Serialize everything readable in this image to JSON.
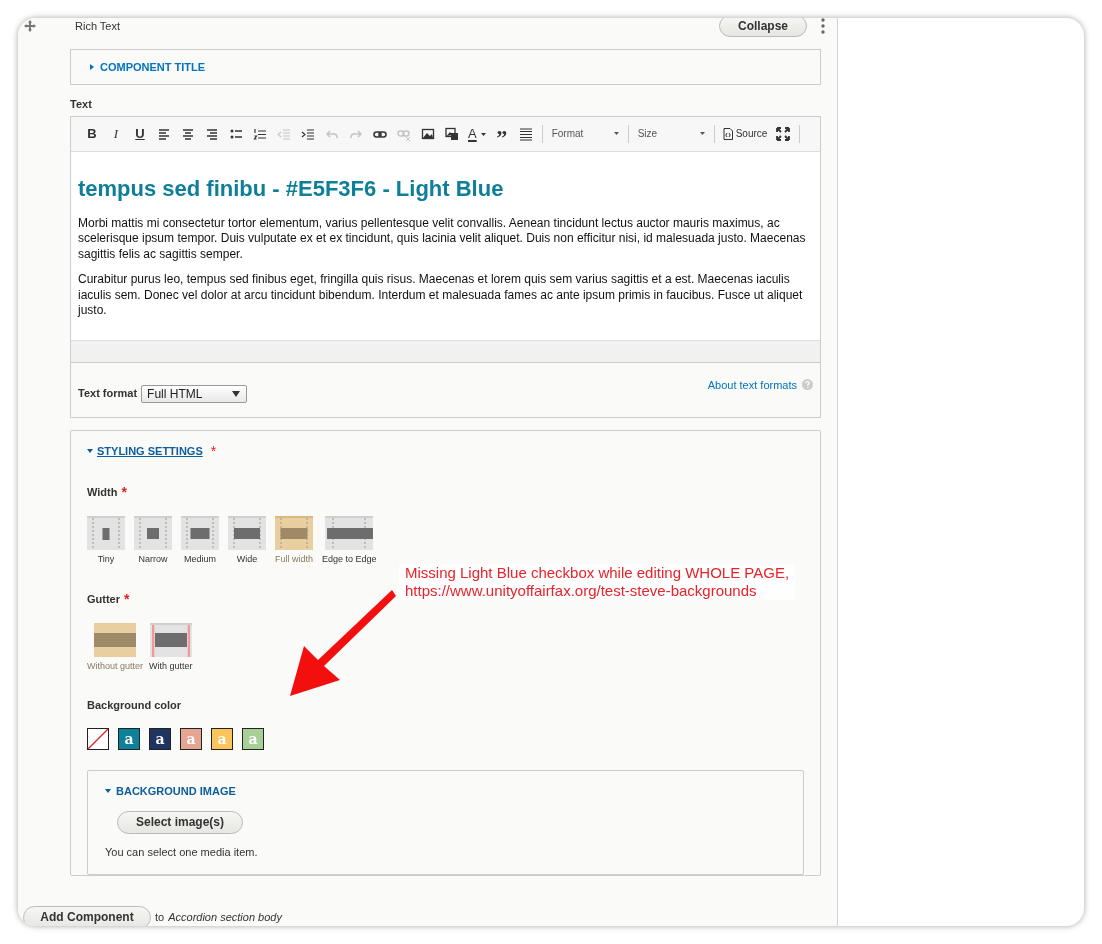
{
  "component": {
    "label": "Rich Text",
    "collapse_button": "Collapse"
  },
  "component_title": {
    "label": "COMPONENT TITLE",
    "expanded": false
  },
  "text_field": {
    "label": "Text",
    "toolbar": [
      {
        "kind": "bold",
        "label": "B",
        "disabled": false
      },
      {
        "kind": "italic",
        "label": "I",
        "disabled": false
      },
      {
        "kind": "underline",
        "label": "U",
        "disabled": false
      },
      {
        "kind": "align-left",
        "disabled": false
      },
      {
        "kind": "align-center",
        "disabled": false
      },
      {
        "kind": "align-right",
        "disabled": false
      },
      {
        "kind": "bullets",
        "disabled": false
      },
      {
        "kind": "numbers",
        "disabled": false
      },
      {
        "kind": "outdent",
        "disabled": true
      },
      {
        "kind": "indent",
        "disabled": false
      },
      {
        "kind": "undo",
        "disabled": true
      },
      {
        "kind": "redo",
        "disabled": true
      },
      {
        "kind": "link",
        "disabled": false
      },
      {
        "kind": "unlink",
        "disabled": true
      },
      {
        "kind": "image",
        "disabled": false
      },
      {
        "kind": "media",
        "disabled": false
      },
      {
        "kind": "text-color",
        "label": "A",
        "disabled": false
      },
      {
        "kind": "quote",
        "label": "”",
        "disabled": false
      },
      {
        "kind": "rule",
        "disabled": false
      },
      {
        "kind": "dropdown",
        "label": "Format",
        "disabled": false
      },
      {
        "kind": "dropdown",
        "label": "Size",
        "disabled": false
      },
      {
        "kind": "source",
        "label": "Source",
        "disabled": false
      },
      {
        "kind": "maximize",
        "disabled": false
      }
    ],
    "heading": "tempus sed finibu - #E5F3F6 - Light Blue",
    "paragraphs": [
      "Morbi mattis mi consectetur tortor elementum, varius pellentesque velit convallis. Aenean tincidunt lectus auctor mauris maximus, ac scelerisque ipsum tempor. Duis vulputate ex et ex tincidunt, quis lacinia velit aliquet. Duis non efficitur nisi, id malesuada justo. Maecenas sagittis felis ac sagittis semper.",
      "Curabitur purus leo, tempus sed finibus eget, fringilla quis risus. Maecenas et lorem quis sem varius sagittis et a est. Maecenas iaculis iaculis sem. Donec vel dolor at arcu tincidunt bibendum. Interdum et malesuada fames ac ante ipsum primis in faucibus. Fusce ut aliquet justo."
    ]
  },
  "text_format": {
    "label": "Text format",
    "value": "Full HTML",
    "help_link": "About text formats"
  },
  "styling": {
    "label": "STYLING SETTINGS",
    "required_mark": "*",
    "expanded": true,
    "width": {
      "label": "Width",
      "required_mark": "*",
      "options": [
        {
          "label": "Tiny",
          "kind": "tiny",
          "selected": false
        },
        {
          "label": "Narrow",
          "kind": "narrow",
          "selected": false
        },
        {
          "label": "Medium",
          "kind": "medium",
          "selected": false
        },
        {
          "label": "Wide",
          "kind": "wide",
          "selected": false
        },
        {
          "label": "Full width",
          "kind": "full",
          "selected": true
        },
        {
          "label": "Edge to Edge",
          "kind": "edge",
          "selected": false
        }
      ]
    },
    "gutter": {
      "label": "Gutter",
      "required_mark": "*",
      "options": [
        {
          "label": "Without gutter",
          "kind": "without",
          "selected": true
        },
        {
          "label": "With gutter",
          "kind": "with",
          "selected": false
        }
      ]
    },
    "background_color": {
      "label": "Background color",
      "options": [
        {
          "kind": "none"
        },
        {
          "kind": "swatch",
          "label": "a",
          "color": "#0f8099"
        },
        {
          "kind": "swatch",
          "label": "a",
          "color": "#1f3461"
        },
        {
          "kind": "swatch",
          "label": "a",
          "color": "#e4a592"
        },
        {
          "kind": "swatch",
          "label": "a",
          "color": "#f9c55c"
        },
        {
          "kind": "swatch",
          "label": "a",
          "color": "#a9cf99"
        }
      ]
    },
    "background_image": {
      "label": "BACKGROUND IMAGE",
      "expanded": true,
      "button": "Select image(s)",
      "help": "You can select one media item."
    }
  },
  "add_component": {
    "button": "Add Component",
    "connector": "to",
    "target": "Accordion section body"
  },
  "annotation": {
    "lines": [
      "Missing Light Blue checkbox while editing WHOLE PAGE,",
      "https://www.unityoffairfax.org/test-steve-backgrounds"
    ]
  }
}
